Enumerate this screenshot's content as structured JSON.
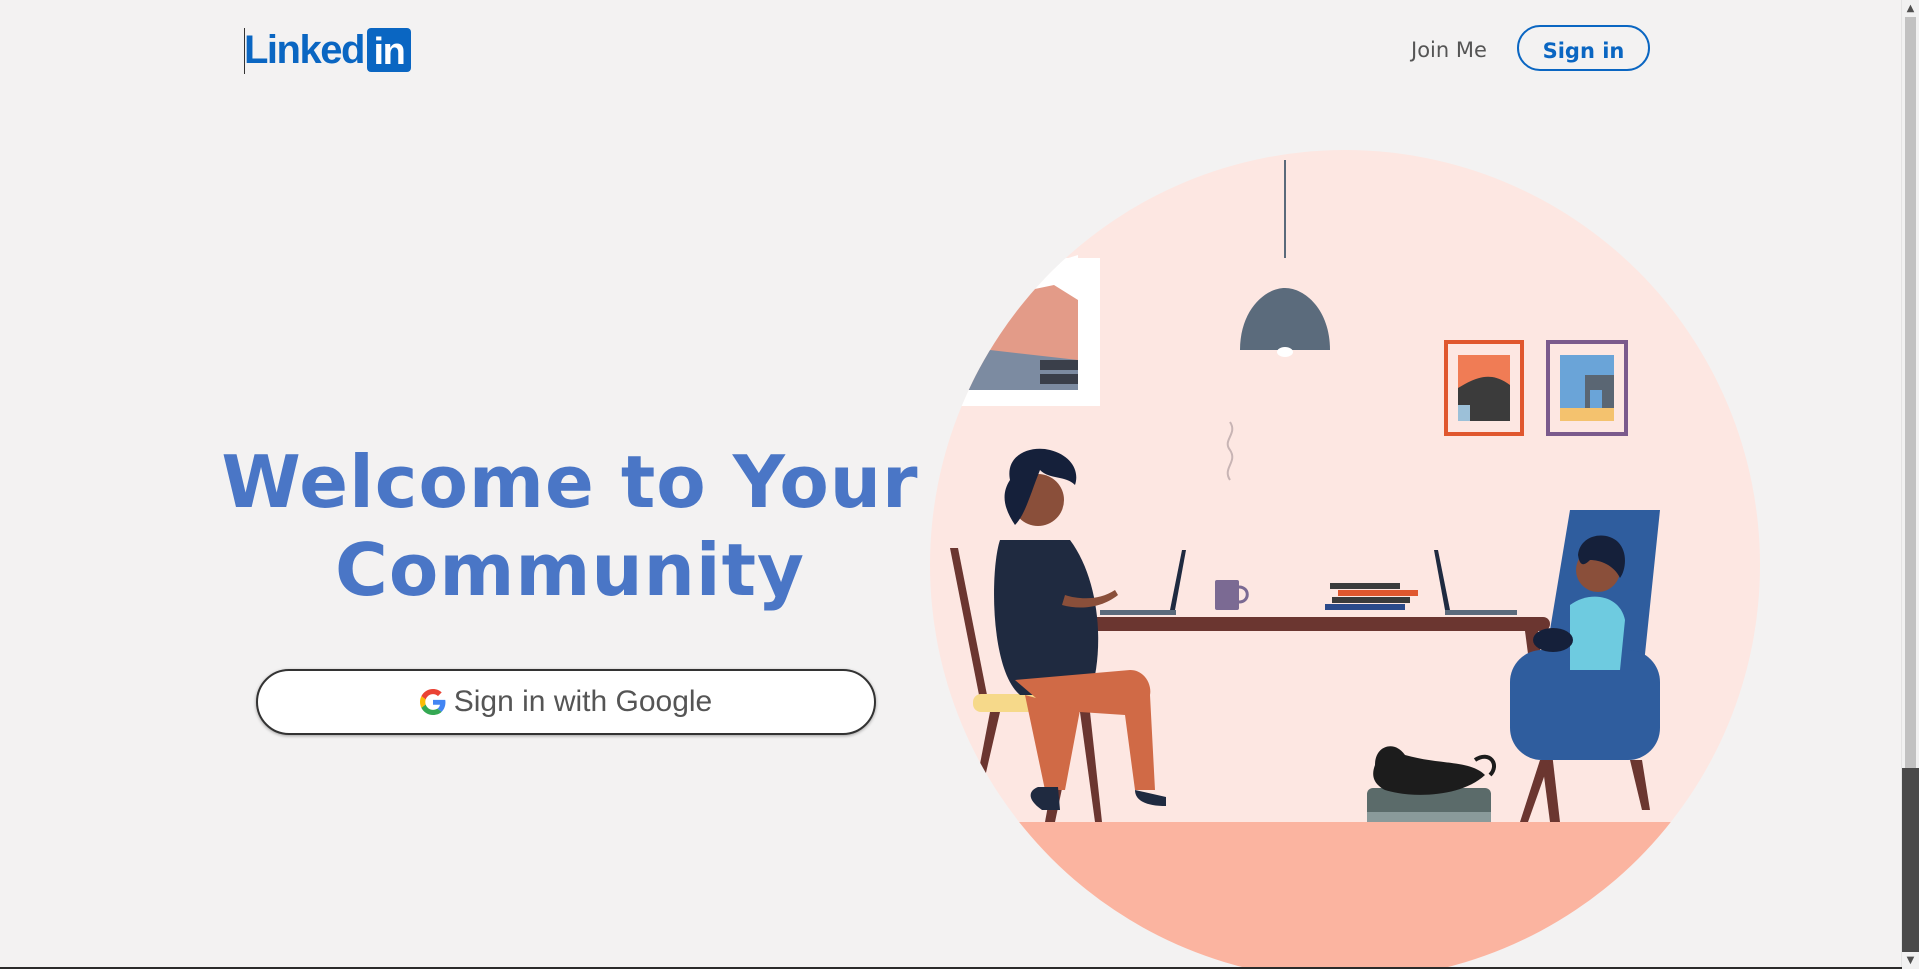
{
  "header": {
    "logo_word": "Linked",
    "logo_box": "in",
    "join_label": "Join Me",
    "signin_label": "Sign in"
  },
  "hero": {
    "title_line1": "Welcome to Your",
    "title_line2": "Community",
    "google_button_label": "Sign in with Google"
  },
  "icons": {
    "logo": "linkedin-logo-icon",
    "google": "google-g-icon",
    "scroll_up": "chevron-up-icon",
    "scroll_down": "chevron-down-icon"
  },
  "colors": {
    "brand_blue": "#0a66c2",
    "title_blue": "#4a76c6",
    "background": "#f3f2f2",
    "illustration_circle": "#fde7e2",
    "floor": "#fbb4a0"
  }
}
